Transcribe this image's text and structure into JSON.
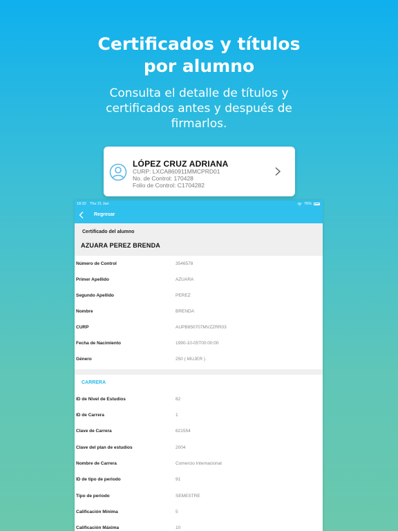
{
  "hero": {
    "title": "Certificados y títulos\npor alumno",
    "subtitle": "Consulta el detalle de títulos y\ncertificados antes y después de\nfirmarlos."
  },
  "card": {
    "name": "LÓPEZ CRUZ ADRIANA",
    "curp": "CURP: LXCA860911MMCPRD01",
    "control": "No. de Control: 170428",
    "folio": "Folio de Control: C1704282"
  },
  "status": {
    "time": "18:32",
    "date": "Thu 21 Jan",
    "battery": "76%"
  },
  "nav": {
    "back_label": "Regresar"
  },
  "certificate": {
    "label": "Certificado del alumno",
    "student_name": "AZUARA PEREZ BRENDA"
  },
  "student_fields": [
    {
      "key": "Número de Control",
      "value": "3546578"
    },
    {
      "key": "Primer Apellido",
      "value": "AZUARA"
    },
    {
      "key": "Segundo Apellido",
      "value": "PEREZ"
    },
    {
      "key": "Nombre",
      "value": "BRENDA"
    },
    {
      "key": "CURP",
      "value": "AUPB850707MVZZRR03"
    },
    {
      "key": "Fecha de Nacimiento",
      "value": "1990-10-05T00:00:00"
    },
    {
      "key": "Género",
      "value": "250 ( MUJER )"
    }
  ],
  "career_section": {
    "title": "CARRERA",
    "fields": [
      {
        "key": "ID de Nivel de Estudios",
        "value": "82"
      },
      {
        "key": "ID de Carrera",
        "value": "1"
      },
      {
        "key": "Clave de Carrera",
        "value": "621554"
      },
      {
        "key": "Clave del plan de estudios",
        "value": "2004"
      },
      {
        "key": "Nombre de Carrera",
        "value": "Comercio Internacional"
      },
      {
        "key": "ID de tipo de periodo",
        "value": "91"
      },
      {
        "key": "Tipo de periodo",
        "value": "SEMESTRE"
      },
      {
        "key": "Calificación Mínima",
        "value": "5"
      },
      {
        "key": "Calificación Máxima",
        "value": "10"
      }
    ]
  }
}
